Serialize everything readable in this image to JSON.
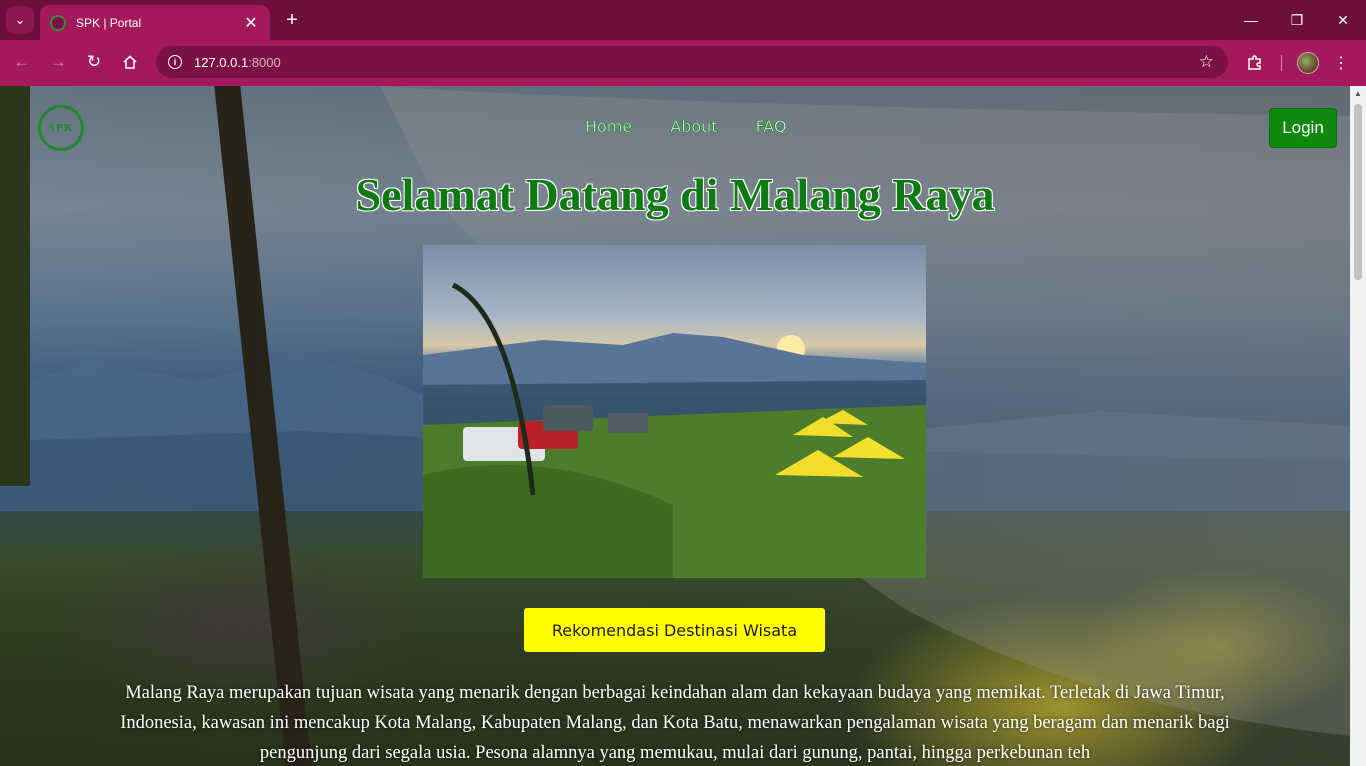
{
  "browser": {
    "tab_title": "SPK | Portal",
    "url_host": "127.0.0.1",
    "url_port": ":8000"
  },
  "nav": {
    "logo_text": "SPK",
    "links": [
      "Home",
      "About",
      "FAQ"
    ],
    "login_label": "Login"
  },
  "hero": {
    "title": "Selamat Datang di Malang Raya",
    "cta_label": "Rekomendasi Destinasi Wisata",
    "intro": "Malang Raya merupakan tujuan wisata yang menarik dengan berbagai keindahan alam dan kekayaan budaya yang memikat. Terletak di Jawa Timur, Indonesia, kawasan ini mencakup Kota Malang, Kabupaten Malang, dan Kota Batu, menawarkan pengalaman wisata yang beragam dan menarik bagi pengunjung dari segala usia. Pesona alamnya yang memukau, mulai dari gunung, pantai, hingga perkebunan teh"
  },
  "colors": {
    "chrome": "#a4195c",
    "title_green": "#0e7a12",
    "login_green": "#0d8a0f",
    "cta_yellow": "#ffff00"
  }
}
